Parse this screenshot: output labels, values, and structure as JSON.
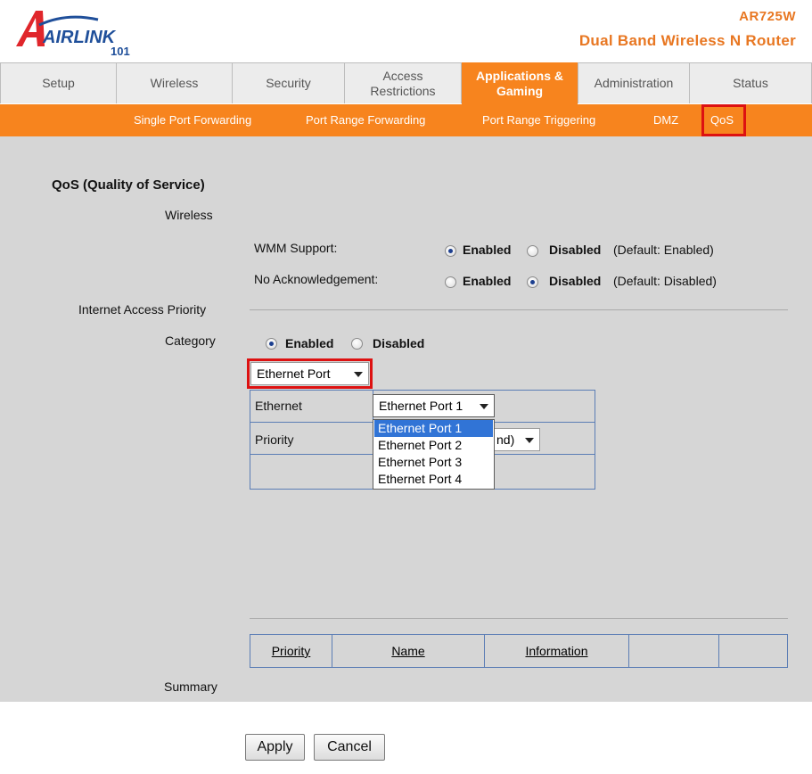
{
  "brand": {
    "logo_text": "AIRLINK",
    "logo_sub": "101",
    "model": "AR725W",
    "product": "Dual Band Wireless N Router",
    "accent_color": "#f7841e"
  },
  "tabs": [
    {
      "label": "Setup"
    },
    {
      "label": "Wireless"
    },
    {
      "label": "Security"
    },
    {
      "label": "Access Restrictions"
    },
    {
      "label": "Applications & Gaming",
      "active": true
    },
    {
      "label": "Administration"
    },
    {
      "label": "Status"
    }
  ],
  "subtabs": [
    {
      "label": "Single Port Forwarding"
    },
    {
      "label": "Port Range Forwarding"
    },
    {
      "label": "Port Range Triggering"
    },
    {
      "label": "DMZ"
    },
    {
      "label": "QoS",
      "active": true
    }
  ],
  "qos": {
    "title": "QoS (Quality of Service)",
    "wireless_label": "Wireless",
    "wmm": {
      "label": "WMM Support:",
      "enabled_label": "Enabled",
      "disabled_label": "Disabled",
      "default_note": "(Default: Enabled)",
      "selected": "enabled"
    },
    "no_ack": {
      "label": "No Acknowledgement:",
      "enabled_label": "Enabled",
      "disabled_label": "Disabled",
      "default_note": "(Default: Disabled)",
      "selected": "disabled"
    },
    "internet_priority_label": "Internet Access Priority",
    "category": {
      "label": "Category",
      "enabled_label": "Enabled",
      "disabled_label": "Disabled",
      "selected": "enabled",
      "type_value": "Ethernet Port"
    },
    "ethernet_row": {
      "label": "Ethernet",
      "value": "Ethernet Port 1",
      "options": [
        "Ethernet Port 1",
        "Ethernet Port 2",
        "Ethernet Port 3",
        "Ethernet Port 4"
      ],
      "highlighted": "Ethernet Port 1"
    },
    "priority_row": {
      "label": "Priority",
      "value_visible": "nd)"
    },
    "summary": {
      "label": "Summary",
      "columns": [
        "Priority",
        "Name",
        "Information",
        "",
        ""
      ]
    }
  },
  "buttons": {
    "apply": "Apply",
    "cancel": "Cancel"
  }
}
